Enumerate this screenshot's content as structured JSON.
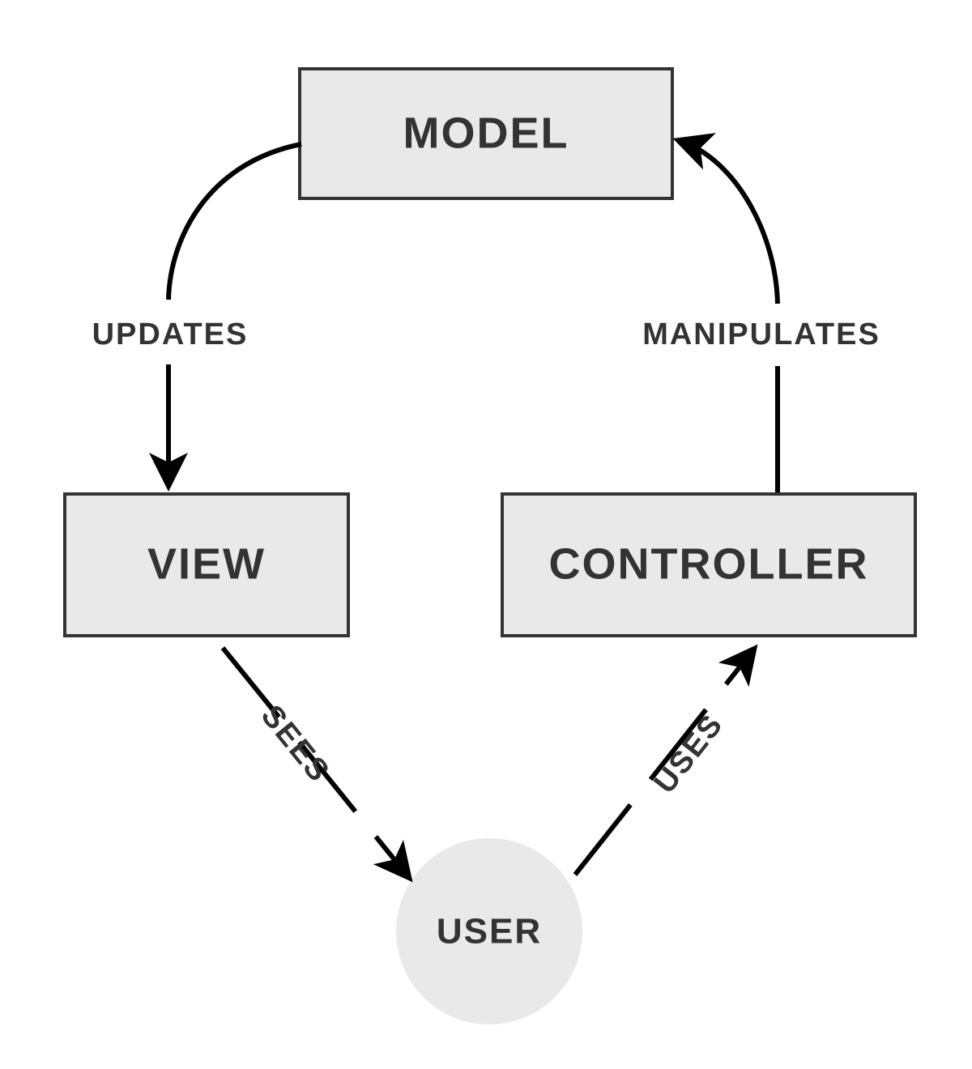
{
  "nodes": {
    "model": {
      "label": "MODEL"
    },
    "view": {
      "label": "VIEW"
    },
    "controller": {
      "label": "CONTROLLER"
    },
    "user": {
      "label": "USER"
    }
  },
  "edges": {
    "updates": {
      "label": "UPDATES",
      "from": "model",
      "to": "view"
    },
    "manipulates": {
      "label": "MANIPULATES",
      "from": "controller",
      "to": "model"
    },
    "sees": {
      "label": "SEES",
      "from": "view",
      "to": "user"
    },
    "uses": {
      "label": "USES",
      "from": "user",
      "to": "controller"
    }
  },
  "colors": {
    "nodeFill": "#e9e9e9",
    "text": "#333333",
    "arrow": "#000000"
  }
}
